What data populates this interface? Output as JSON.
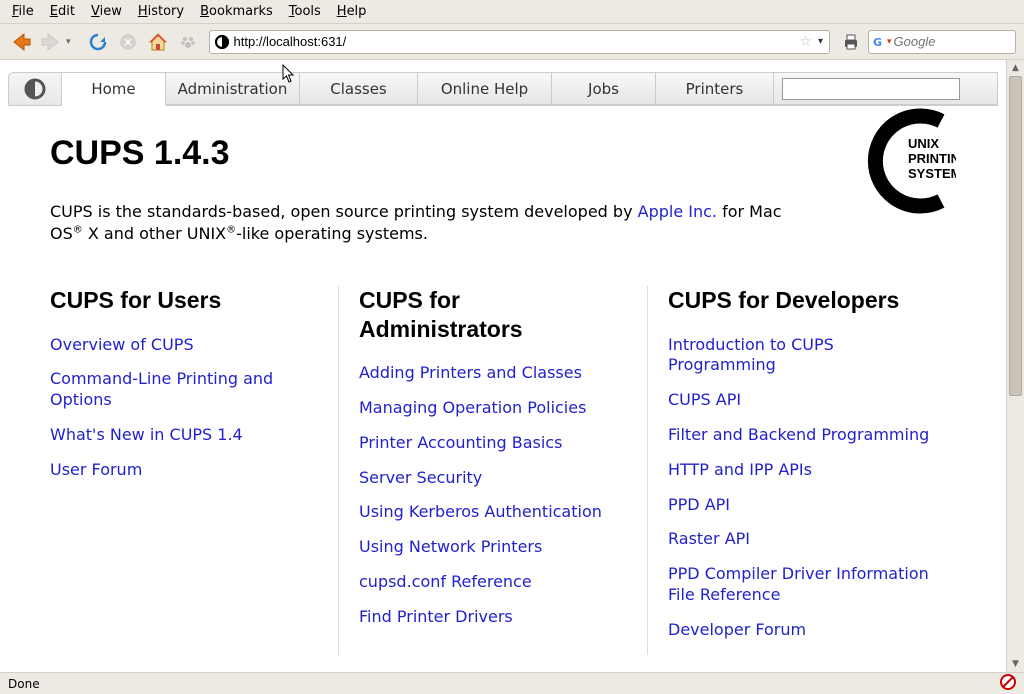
{
  "menubar": [
    "File",
    "Edit",
    "View",
    "History",
    "Bookmarks",
    "Tools",
    "Help"
  ],
  "toolbar": {
    "url": "http://localhost:631/",
    "search_placeholder": "Google"
  },
  "cups": {
    "tabs": [
      "Home",
      "Administration",
      "Classes",
      "Online Help",
      "Jobs",
      "Printers"
    ],
    "title": "CUPS 1.4.3",
    "intro_pre": "CUPS is the standards-based, open source printing system developed by ",
    "intro_link": "Apple Inc.",
    "intro_post1": " for Mac OS",
    "intro_post2": " X and other UNIX",
    "intro_post3": "-like operating systems.",
    "logo_lines": [
      "UNIX",
      "PRINTING",
      "SYSTEM"
    ],
    "col_users": {
      "heading": "CUPS for Users",
      "links": [
        "Overview of CUPS",
        "Command-Line Printing and Options",
        "What's New in CUPS 1.4",
        "User Forum"
      ]
    },
    "col_admins": {
      "heading": "CUPS for Administrators",
      "links": [
        "Adding Printers and Classes",
        "Managing Operation Policies",
        "Printer Accounting Basics",
        "Server Security",
        "Using Kerberos Authentication",
        "Using Network Printers",
        "cupsd.conf Reference",
        "Find Printer Drivers"
      ]
    },
    "col_devs": {
      "heading": "CUPS for Developers",
      "links": [
        "Introduction to CUPS Programming",
        "CUPS API",
        "Filter and Backend Programming",
        "HTTP and IPP APIs",
        "PPD API",
        "Raster API",
        "PPD Compiler Driver Information File Reference",
        "Developer Forum"
      ]
    }
  },
  "statusbar": {
    "text": "Done"
  }
}
